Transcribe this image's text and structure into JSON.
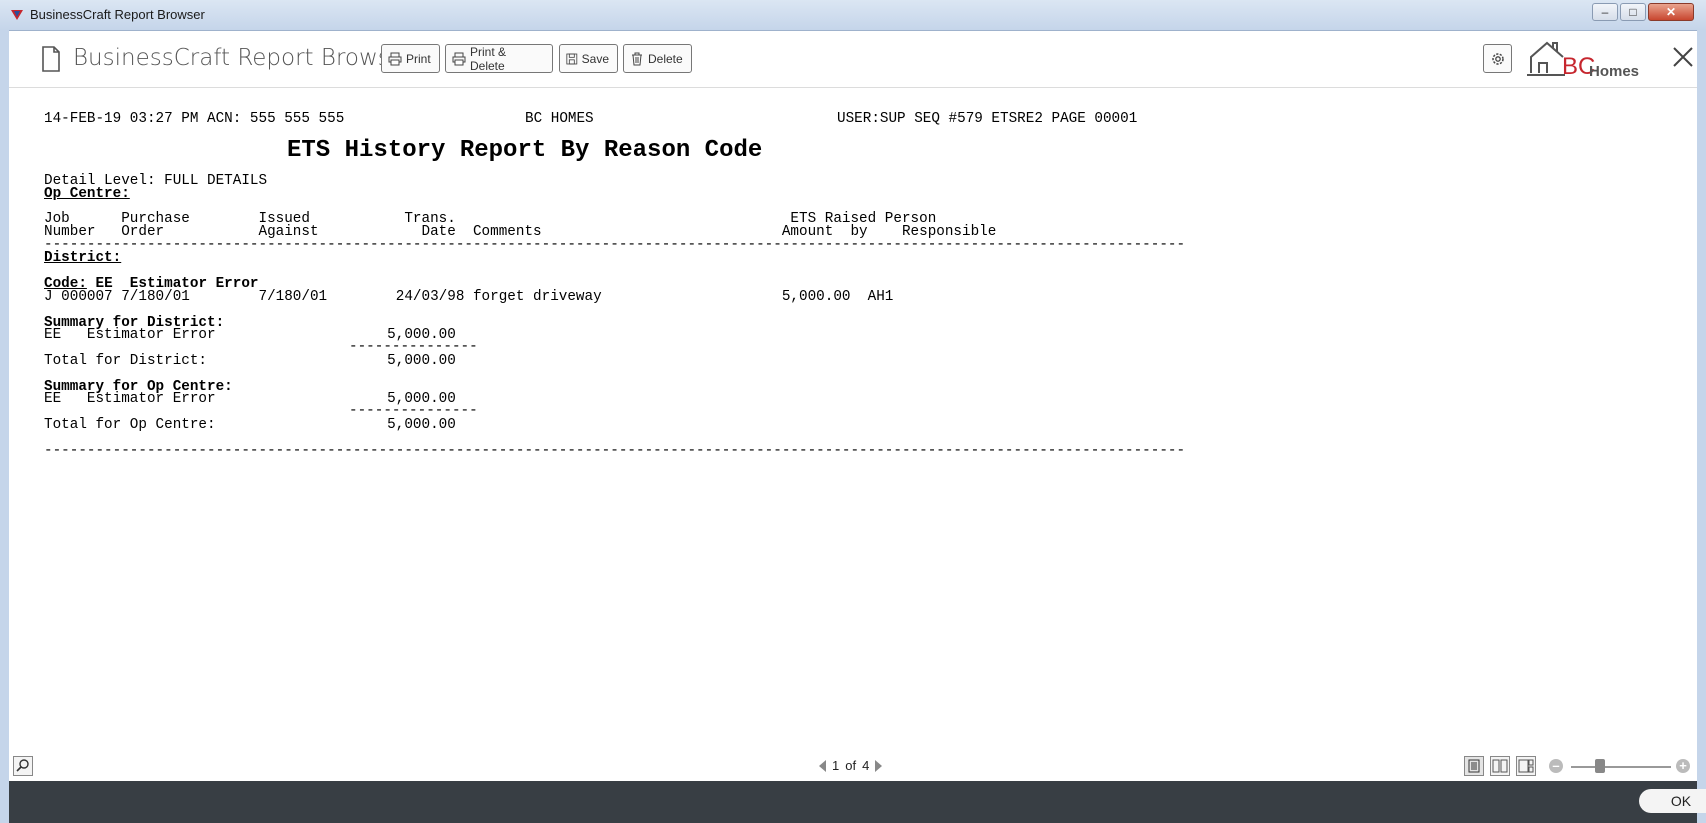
{
  "window": {
    "title": "BusinessCraft Report Browser",
    "min_glyph": "–",
    "max_glyph": "□",
    "close_glyph": "✕"
  },
  "toolbar": {
    "app_title": "BusinessCraft Report Browser",
    "print_label": "Print",
    "print_delete_label": "Print & Delete",
    "save_label": "Save",
    "delete_label": "Delete"
  },
  "logo": {
    "bc": "BC",
    "homes": "Homes"
  },
  "report": {
    "header_left": "14-FEB-19 03:27 PM ACN: 555 555 555",
    "header_center": "BC HOMES",
    "header_right": "USER:SUP SEQ #579 ETSRE2 PAGE 00001",
    "title": "ETS History Report By Reason Code",
    "detail_level": "Detail Level: FULL DETAILS",
    "op_centre_heading": "Op Centre:",
    "col_headers_row1": "Job      Purchase        Issued           Trans.                                       ETS Raised Person",
    "col_headers_row2": "Number   Order           Against            Date  Comments                            Amount  by    Responsible",
    "separator": "-------------------------------------------------------------------------------------------------------------------------------------",
    "district_heading": "District:",
    "code_label": "Code:",
    "code_value": " EE  Estimator Error",
    "detail_row": "J 000007 7/180/01        7/180/01        24/03/98 forget driveway                     5,000.00  AH1",
    "summary_district": "Summary for District:",
    "summary_district_row": "EE   Estimator Error                    5,000.00",
    "subtotal_line": "---------------",
    "total_district": "Total for District:                     5,000.00",
    "summary_op": "Summary for Op Centre:",
    "summary_op_row": "EE   Estimator Error                    5,000.00",
    "total_op": "Total for Op Centre:                    5,000.00"
  },
  "pager": {
    "current": "1",
    "of": "of",
    "total": "4"
  },
  "footer": {
    "ok_label": "OK"
  }
}
